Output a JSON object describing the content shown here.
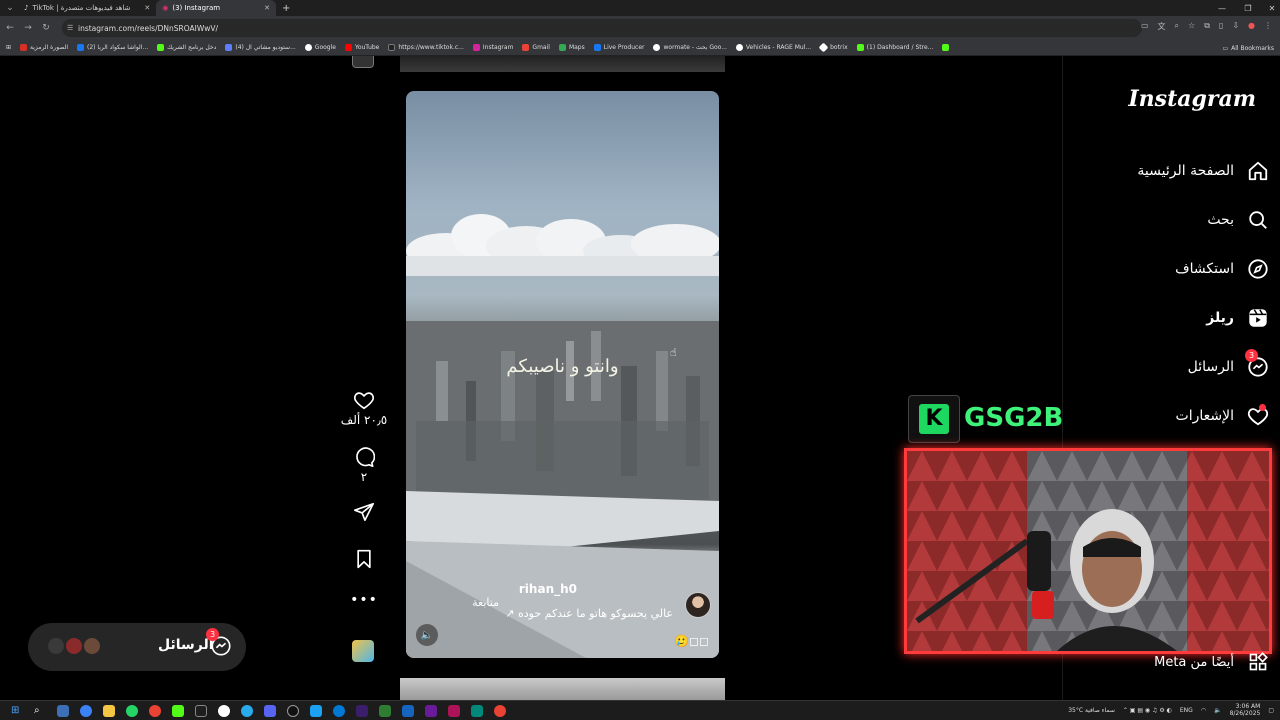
{
  "browser": {
    "tabs": [
      {
        "title": "TikTok | شاهد فيديوهات متصدرة",
        "active": false
      },
      {
        "title": "(3) Instagram",
        "active": true
      }
    ],
    "new_tab": "+",
    "url": "instagram.com/reels/DNnSROAIWwV/",
    "bookmarks": [
      {
        "label": "الصورة الرمزية",
        "color": "#d93025"
      },
      {
        "label": "(2) الواشا سكواد الربا...",
        "color": "#1877f2"
      },
      {
        "label": "دخل برنامج الشريك",
        "color": "#53fc18"
      },
      {
        "label": "(4) ستوديو مشاتي ال...",
        "color": "#5b7fff"
      },
      {
        "label": "Google",
        "color": "#ffffff"
      },
      {
        "label": "YouTube",
        "color": "#ff0000"
      },
      {
        "label": "https://www.tiktok.c...",
        "color": "#222222"
      },
      {
        "label": "Instagram",
        "color": "#d6249f"
      },
      {
        "label": "Gmail",
        "color": "#ea4335"
      },
      {
        "label": "Maps",
        "color": "#34a853"
      },
      {
        "label": "Live Producer",
        "color": "#1877f2"
      },
      {
        "label": "wormate - بحث Goo...",
        "color": "#ffffff"
      },
      {
        "label": "Vehicles - RAGE Mul...",
        "color": "#ffffff"
      },
      {
        "label": "botrix",
        "color": "#ffffff"
      },
      {
        "label": "(1) Dashboard / Stre...",
        "color": "#53fc18"
      }
    ],
    "all_bookmarks": "All Bookmarks"
  },
  "sidebar": {
    "logo": "Instagram",
    "items": [
      {
        "label": "الصفحة الرئيسية",
        "icon": "home-icon"
      },
      {
        "label": "بحث",
        "icon": "search-icon"
      },
      {
        "label": "استكشاف",
        "icon": "compass-icon"
      },
      {
        "label": "ريلز",
        "icon": "reels-icon"
      },
      {
        "label": "الرسائل",
        "icon": "messenger-icon",
        "badge": "3"
      },
      {
        "label": "الإشعارات",
        "icon": "heart-icon"
      }
    ],
    "meta": "أيضًا من Meta"
  },
  "reel": {
    "overlay_text": "وانتو و ناصيبكم",
    "username": "rihan_h0",
    "follow": "متابعة",
    "description": "عالي يحسوكو هاتو ما عندكم  حوده",
    "emoji": "🥲◻◻"
  },
  "actions": {
    "likes": "٢٠٫٥ ألف",
    "comments": "٢"
  },
  "messages_pill": {
    "label": "الرسائل",
    "badge": "3"
  },
  "stream": {
    "brand_letter": "K",
    "brand_text": "GSG2B"
  },
  "taskbar": {
    "weather": "35°C  سماء صافية",
    "lang": "ENG",
    "time": "3:06 AM",
    "date": "8/26/2025"
  }
}
